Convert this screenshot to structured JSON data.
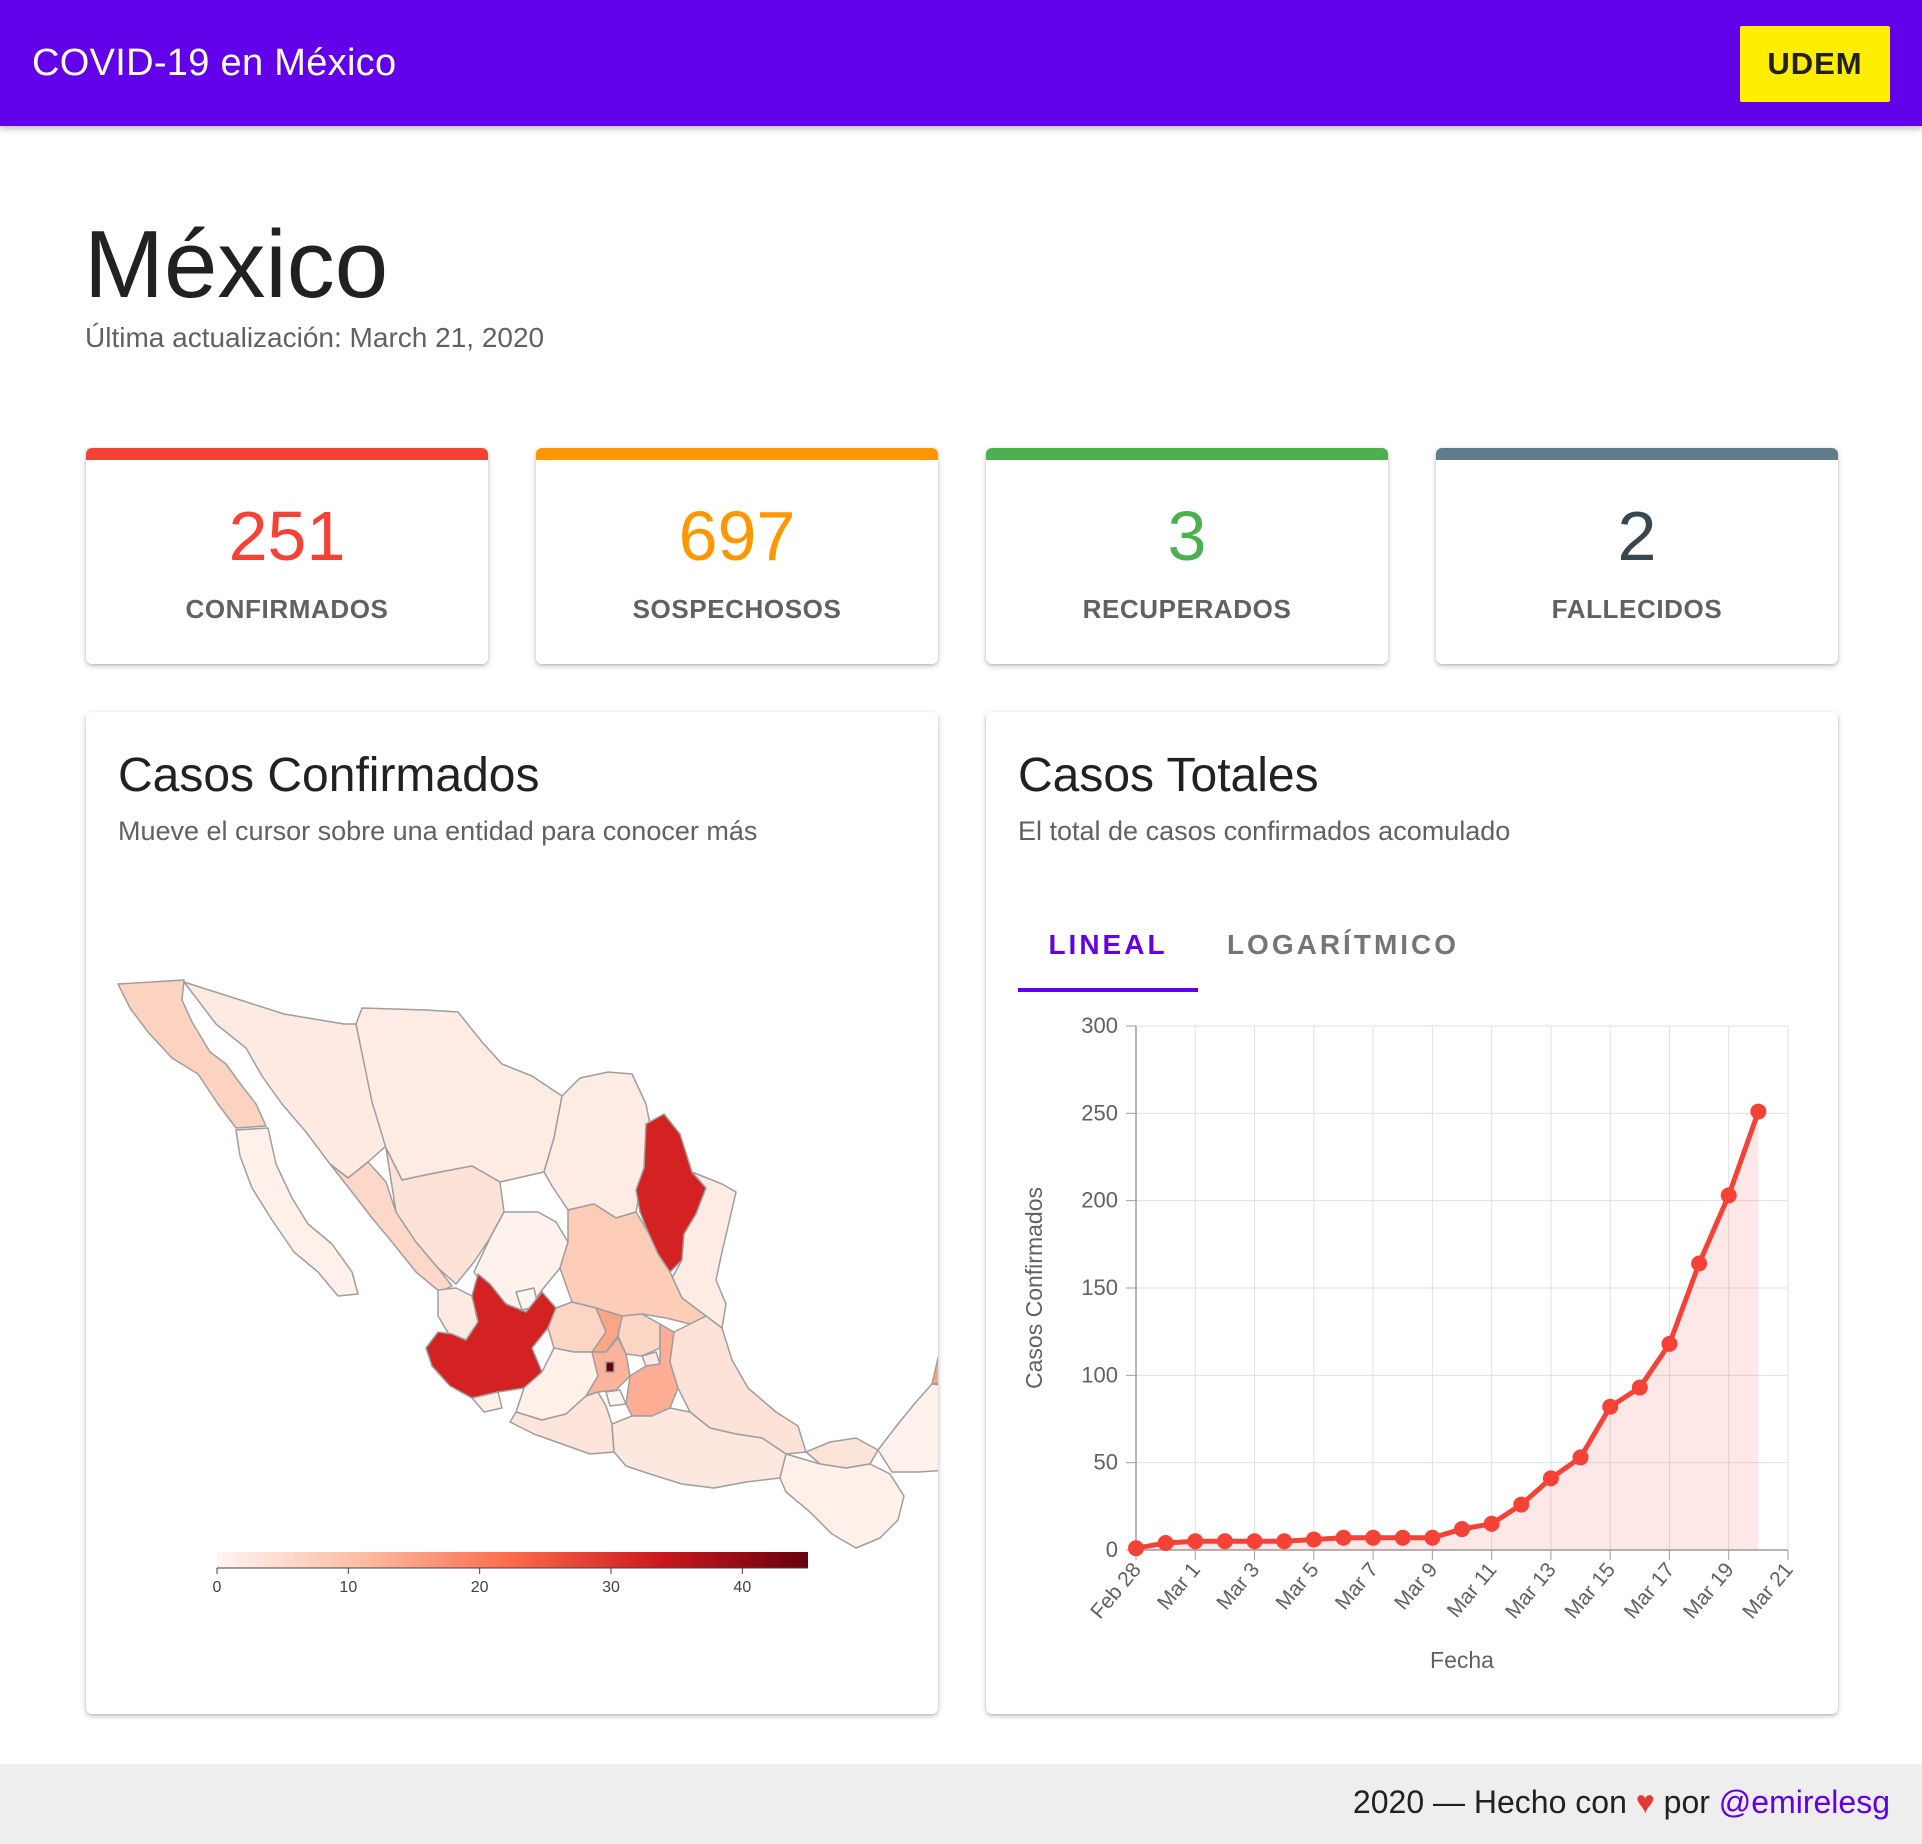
{
  "app": {
    "title": "COVID-19 en México",
    "udem_label": "UDEM"
  },
  "page": {
    "title": "México",
    "subtitle": "Última actualización: March 21, 2020"
  },
  "stats": [
    {
      "value": "251",
      "label": "CONFIRMADOS",
      "color": "#f44336"
    },
    {
      "value": "697",
      "label": "SOSPECHOSOS",
      "color": "#ff9800"
    },
    {
      "value": "3",
      "label": "RECUPERADOS",
      "color": "#4caf50"
    },
    {
      "value": "2",
      "label": "FALLECIDOS",
      "color": "#607d8b",
      "value_color": "#37474f"
    }
  ],
  "map_panel": {
    "title": "Casos Confirmados",
    "subtitle": "Mueve el cursor sobre una entidad para conocer más",
    "legend_ticks": [
      "0",
      "10",
      "20",
      "30",
      "40"
    ],
    "legend_range": [
      0,
      45
    ]
  },
  "chart_panel": {
    "title": "Casos Totales",
    "subtitle": "El total de casos confirmados acomulado",
    "tabs": [
      {
        "label": "LINEAL",
        "active": true
      },
      {
        "label": "LOGARÍTMICO",
        "active": false
      }
    ]
  },
  "chart_data": {
    "type": "area",
    "xlabel": "Fecha",
    "ylabel": "Casos Confirmados",
    "ylim": [
      0,
      300
    ],
    "yticks": [
      "0",
      "50",
      "100",
      "150",
      "200",
      "250",
      "300"
    ],
    "x": [
      "Feb 28",
      "Feb 29",
      "Mar 1",
      "Mar 2",
      "Mar 3",
      "Mar 4",
      "Mar 5",
      "Mar 6",
      "Mar 7",
      "Mar 8",
      "Mar 9",
      "Mar 10",
      "Mar 11",
      "Mar 12",
      "Mar 13",
      "Mar 14",
      "Mar 15",
      "Mar 16",
      "Mar 17",
      "Mar 18",
      "Mar 19",
      "Mar 20",
      "Mar 21"
    ],
    "xtick_labels": [
      "Feb 28",
      "Mar 1",
      "Mar 3",
      "Mar 5",
      "Mar 7",
      "Mar 9",
      "Mar 11",
      "Mar 13",
      "Mar 15",
      "Mar 17",
      "Mar 19",
      "Mar 21"
    ],
    "series": [
      {
        "values": [
          1,
          4,
          5,
          5,
          5,
          5,
          6,
          7,
          7,
          7,
          7,
          12,
          15,
          26,
          41,
          53,
          82,
          93,
          118,
          164,
          203,
          251
        ],
        "color": "#f44336"
      }
    ],
    "grid": true
  },
  "footer": {
    "prefix": "2020 — Hecho con ",
    "heart": "♥",
    "middle": " por ",
    "link": "@emirelesg"
  }
}
